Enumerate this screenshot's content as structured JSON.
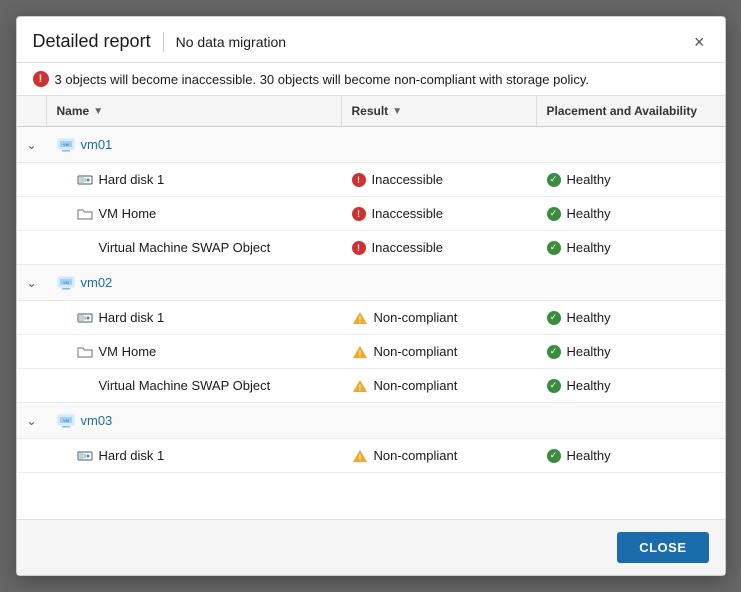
{
  "dialog": {
    "title": "Detailed report",
    "subtitle": "No data migration",
    "close_x": "×",
    "alert": "3 objects will become inaccessible. 30 objects will become non-compliant with storage policy.",
    "table": {
      "columns": [
        "",
        "Name",
        "Result",
        "Placement and Availability"
      ],
      "vms": [
        {
          "name": "vm01",
          "children": [
            {
              "icon": "harddisk",
              "name": "Hard disk 1",
              "result": "Inaccessible",
              "result_type": "error",
              "placement": "Healthy"
            },
            {
              "icon": "folder",
              "name": "VM Home",
              "result": "Inaccessible",
              "result_type": "error",
              "placement": "Healthy"
            },
            {
              "icon": "none",
              "name": "Virtual Machine SWAP Object",
              "result": "Inaccessible",
              "result_type": "error",
              "placement": "Healthy"
            }
          ]
        },
        {
          "name": "vm02",
          "children": [
            {
              "icon": "harddisk",
              "name": "Hard disk 1",
              "result": "Non-compliant",
              "result_type": "warn",
              "placement": "Healthy"
            },
            {
              "icon": "folder",
              "name": "VM Home",
              "result": "Non-compliant",
              "result_type": "warn",
              "placement": "Healthy"
            },
            {
              "icon": "none",
              "name": "Virtual Machine SWAP Object",
              "result": "Non-compliant",
              "result_type": "warn",
              "placement": "Healthy"
            }
          ]
        },
        {
          "name": "vm03",
          "children": [
            {
              "icon": "harddisk",
              "name": "Hard disk 1",
              "result": "Non-compliant",
              "result_type": "warn",
              "placement": "Healthy"
            }
          ]
        }
      ]
    },
    "footer": {
      "close_label": "CLOSE"
    }
  }
}
